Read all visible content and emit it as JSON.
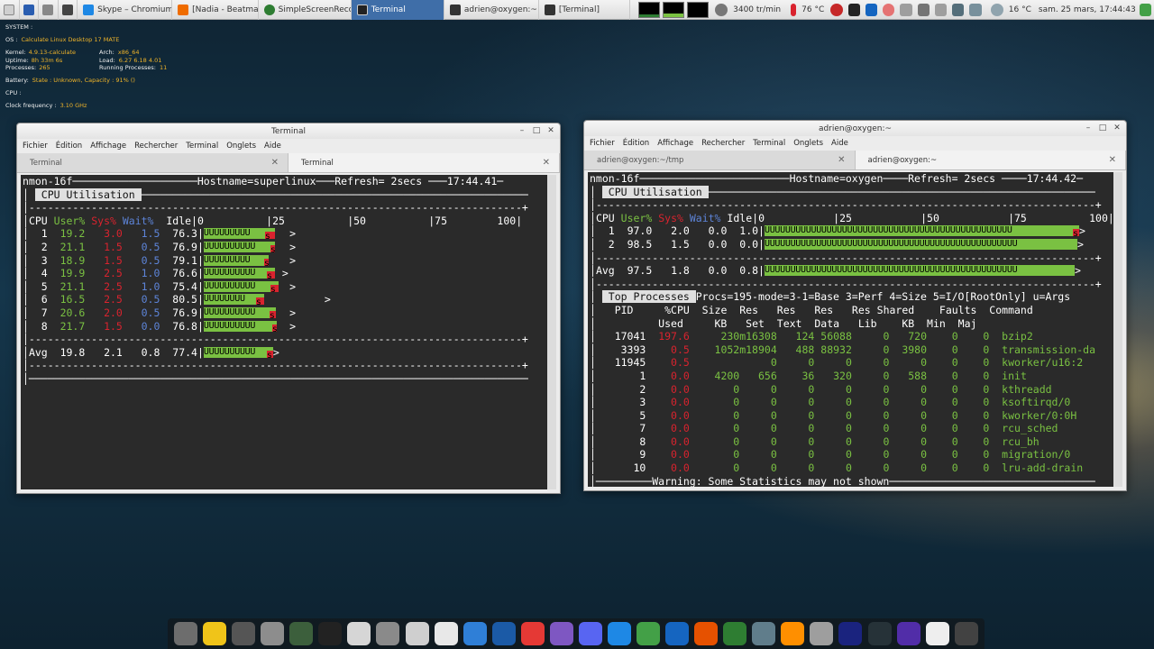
{
  "taskbar": {
    "tasks": [
      {
        "label": "Skype – Chromium",
        "active": false
      },
      {
        "label": "[Nadia - Beatman (...",
        "active": false
      },
      {
        "label": "SimpleScreenRecor...",
        "active": false
      },
      {
        "label": "Terminal",
        "active": true
      },
      {
        "label": "adrien@oxygen:~",
        "active": false
      },
      {
        "label": "[Terminal]",
        "active": false
      }
    ],
    "fan": "3400 tr/min",
    "cpu_temp": "76 °C",
    "weather": "16 °C",
    "clock": "sam. 25 mars, 17:44:43"
  },
  "conky": {
    "system_header": "SYSTEM :",
    "os_label": "OS :",
    "os": "Calculate Linux Desktop 17 MATE",
    "kernel_label": "Kernel:",
    "kernel": "4.9.13-calculate",
    "arch_label": "Arch:",
    "arch": "x86_64",
    "uptime_label": "Uptime:",
    "uptime": "8h 33m 6s",
    "load_label": "Load:",
    "load": "6.27 6.18 4.01",
    "processes_label": "Processes:",
    "processes": "265",
    "running_label": "Running Processes:",
    "running": "11",
    "battery_label": "Battery:",
    "battery": "State : Unknown,  Capacity : 91%  ()",
    "cpu_header": "CPU :",
    "clock_label": "Clock frequency :",
    "clock": "3.10 GHz"
  },
  "left_window": {
    "title": "Terminal",
    "menu": [
      "Fichier",
      "Édition",
      "Affichage",
      "Rechercher",
      "Terminal",
      "Onglets",
      "Aide"
    ],
    "tabs": [
      "Terminal",
      "Terminal"
    ],
    "header": "nmon-16f",
    "hostname": "Hostname=superlinux",
    "refresh": "Refresh= 2secs",
    "time": "17:44.41",
    "section": "CPU Utilisation",
    "col_cpu": "CPU",
    "col_user": "User%",
    "col_sys": "Sys%",
    "col_wait": "Wait%",
    "col_idle": "Idle",
    "scale": [
      "0",
      "25",
      "50",
      "75",
      "100"
    ],
    "rows": [
      {
        "cpu": "1",
        "user": "19.2",
        "sys": "3.0",
        "wait": "1.5",
        "idle": "76.3",
        "u": 19.2,
        "s": 3.0,
        "peak": 27
      },
      {
        "cpu": "2",
        "user": "21.1",
        "sys": "1.5",
        "wait": "0.5",
        "idle": "76.9",
        "u": 21.1,
        "s": 1.5,
        "peak": 27
      },
      {
        "cpu": "3",
        "user": "18.9",
        "sys": "1.5",
        "wait": "0.5",
        "idle": "79.1",
        "u": 18.9,
        "s": 1.5,
        "peak": 27
      },
      {
        "cpu": "4",
        "user": "19.9",
        "sys": "2.5",
        "wait": "1.0",
        "idle": "76.6",
        "u": 19.9,
        "s": 2.5,
        "peak": 23
      },
      {
        "cpu": "5",
        "user": "21.1",
        "sys": "2.5",
        "wait": "1.0",
        "idle": "75.4",
        "u": 21.1,
        "s": 2.5,
        "peak": 27
      },
      {
        "cpu": "6",
        "user": "16.5",
        "sys": "2.5",
        "wait": "0.5",
        "idle": "80.5",
        "u": 16.5,
        "s": 2.5,
        "peak": 38
      },
      {
        "cpu": "7",
        "user": "20.6",
        "sys": "2.0",
        "wait": "0.5",
        "idle": "76.9",
        "u": 20.6,
        "s": 2.0,
        "peak": 27
      },
      {
        "cpu": "8",
        "user": "21.7",
        "sys": "1.5",
        "wait": "0.0",
        "idle": "76.8",
        "u": 21.7,
        "s": 1.5,
        "peak": 27
      }
    ],
    "avg": {
      "cpu": "Avg",
      "user": "19.8",
      "sys": "2.1",
      "wait": "0.8",
      "idle": "77.4",
      "u": 19.8,
      "s": 2.1
    }
  },
  "right_window": {
    "title": "adrien@oxygen:~",
    "menu": [
      "Fichier",
      "Édition",
      "Affichage",
      "Rechercher",
      "Terminal",
      "Onglets",
      "Aide"
    ],
    "tabs": [
      "adrien@oxygen:~/tmp",
      "adrien@oxygen:~"
    ],
    "header": "nmon-16f",
    "hostname": "Hostname=oxygen",
    "refresh": "Refresh= 2secs",
    "time": "17:44.42",
    "section": "CPU Utilisation",
    "col_cpu": "CPU",
    "col_user": "User%",
    "col_sys": "Sys%",
    "col_wait": "Wait%",
    "col_idle": "Idle",
    "scale": [
      "0",
      "25",
      "50",
      "75",
      "100"
    ],
    "rows": [
      {
        "cpu": "1",
        "user": "97.0",
        "sys": "2.0",
        "wait": "0.0",
        "idle": "1.0",
        "u": 97.0,
        "s": 2.0
      },
      {
        "cpu": "2",
        "user": "98.5",
        "sys": "1.5",
        "wait": "0.0",
        "idle": "0.0",
        "u": 98.5,
        "s": 0.0
      }
    ],
    "avg": {
      "cpu": "Avg",
      "user": "97.5",
      "sys": "1.8",
      "wait": "0.0",
      "idle": "0.8",
      "u": 97.5,
      "s": 0.0
    },
    "top_section": "Top Processes",
    "top_info": "Procs=195-mode=3-1=Base 3=Perf 4=Size 5=I/O[RootOnly] u=Args",
    "top_head1": [
      "PID",
      "%CPU",
      "Size",
      "Res",
      "Res",
      "Res",
      "Res",
      "Shared",
      "Faults",
      "Command"
    ],
    "top_head2": [
      "Used",
      "KB",
      "Set",
      "Text",
      "Data",
      "Lib",
      "KB",
      "Min",
      "Maj"
    ],
    "procs": [
      {
        "pid": "17041",
        "cpu": "197.6",
        "size": "230m16308",
        "text": "124",
        "data": "56088",
        "lib": "0",
        "shared": "720",
        "min": "0",
        "maj": "0",
        "cmd": "bzip2"
      },
      {
        "pid": "3393",
        "cpu": "0.5",
        "size": "1052m18904",
        "text": "488",
        "data": "88932",
        "lib": "0",
        "shared": "3980",
        "min": "0",
        "maj": "0",
        "cmd": "transmission-da"
      },
      {
        "pid": "11945",
        "cpu": "0.5",
        "size": "0",
        "text": "0",
        "data": "0",
        "lib": "0",
        "shared": "0",
        "min": "0",
        "maj": "0",
        "cmd": "kworker/u16:2"
      },
      {
        "pid": "1",
        "cpu": "0.0",
        "size": "4200",
        "res": "656",
        "text": "36",
        "data": "320",
        "lib": "0",
        "shared": "588",
        "min": "0",
        "maj": "0",
        "cmd": "init"
      },
      {
        "pid": "2",
        "cpu": "0.0",
        "size": "0",
        "res": "0",
        "text": "0",
        "data": "0",
        "lib": "0",
        "shared": "0",
        "min": "0",
        "maj": "0",
        "cmd": "kthreadd"
      },
      {
        "pid": "3",
        "cpu": "0.0",
        "size": "0",
        "res": "0",
        "text": "0",
        "data": "0",
        "lib": "0",
        "shared": "0",
        "min": "0",
        "maj": "0",
        "cmd": "ksoftirqd/0"
      },
      {
        "pid": "5",
        "cpu": "0.0",
        "size": "0",
        "res": "0",
        "text": "0",
        "data": "0",
        "lib": "0",
        "shared": "0",
        "min": "0",
        "maj": "0",
        "cmd": "kworker/0:0H"
      },
      {
        "pid": "7",
        "cpu": "0.0",
        "size": "0",
        "res": "0",
        "text": "0",
        "data": "0",
        "lib": "0",
        "shared": "0",
        "min": "0",
        "maj": "0",
        "cmd": "rcu_sched"
      },
      {
        "pid": "8",
        "cpu": "0.0",
        "size": "0",
        "res": "0",
        "text": "0",
        "data": "0",
        "lib": "0",
        "shared": "0",
        "min": "0",
        "maj": "0",
        "cmd": "rcu_bh"
      },
      {
        "pid": "9",
        "cpu": "0.0",
        "size": "0",
        "res": "0",
        "text": "0",
        "data": "0",
        "lib": "0",
        "shared": "0",
        "min": "0",
        "maj": "0",
        "cmd": "migration/0"
      },
      {
        "pid": "10",
        "cpu": "0.0",
        "size": "0",
        "res": "0",
        "text": "0",
        "data": "0",
        "lib": "0",
        "shared": "0",
        "min": "0",
        "maj": "0",
        "cmd": "lru-add-drain"
      }
    ],
    "warning": "Warning: Some Statistics may not shown"
  },
  "dock": {
    "icons": [
      "synaptic-icon",
      "clock-icon",
      "calculator-icon",
      "network-icon",
      "system-monitor-icon",
      "terminal-icon",
      "text-editor-icon",
      "screenshot-icon",
      "disks-icon",
      "file-manager-icon",
      "chromium-icon",
      "thunderbird-icon",
      "vivaldi-icon",
      "hexchat-icon",
      "discord-icon",
      "mate-monitor-icon",
      "calc-icon",
      "writer-icon",
      "impress-icon",
      "emoji-icon",
      "transmission-icon",
      "audacious-icon",
      "software-center-icon",
      "kodi-icon",
      "steam-icon",
      "virtualbox-icon",
      "wifi-icon",
      "trash-icon"
    ]
  }
}
